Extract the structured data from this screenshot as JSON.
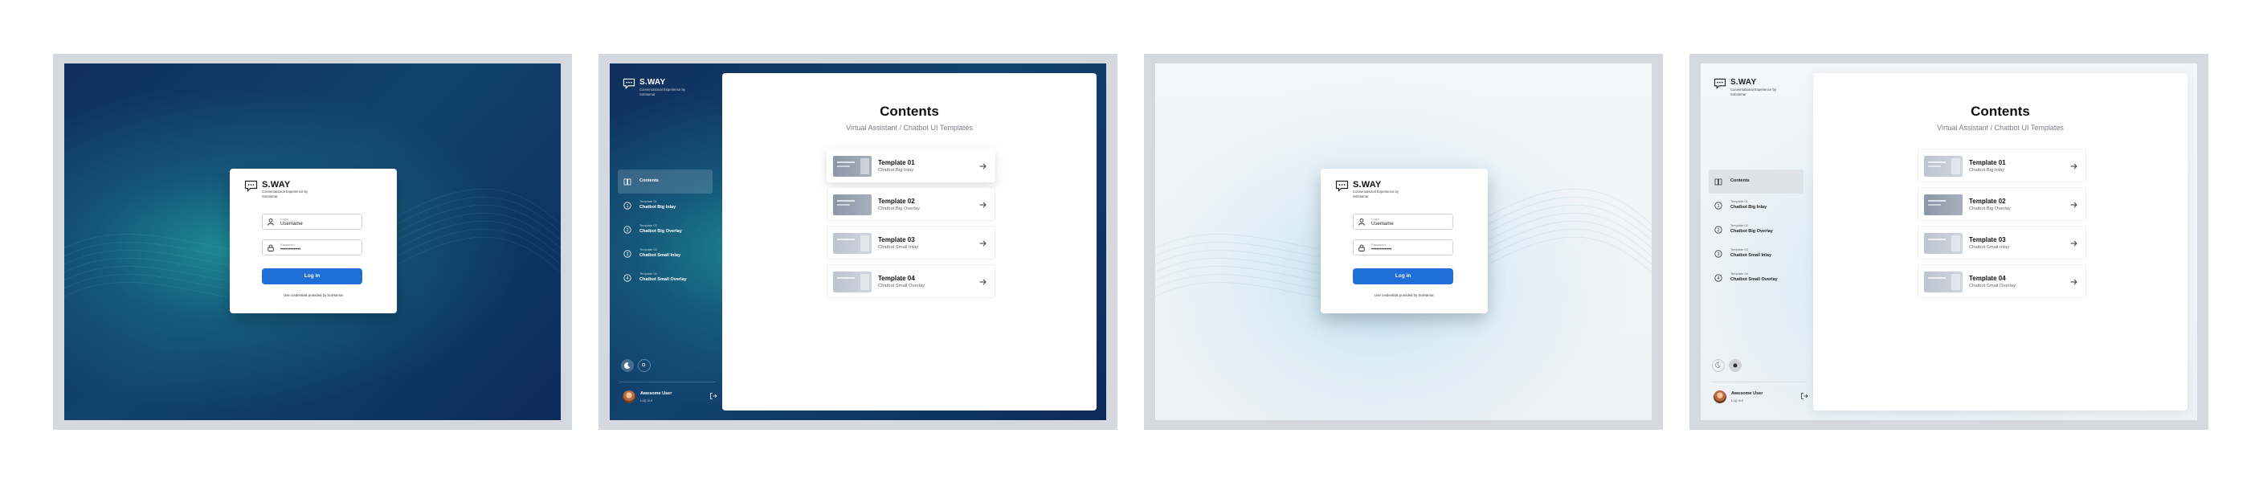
{
  "brand": {
    "name": "S.WAY",
    "tagline": "Conversational Experience by SotHarnar"
  },
  "login": {
    "id_label": "Login",
    "id_value": "Username",
    "pw_label": "Password",
    "pw_value": "••••••••••••",
    "button": "Log in",
    "note": "Use credentials provided by SotHarnar"
  },
  "content": {
    "title": "Contents",
    "subtitle": "Virtual Assistant / Chatbot UI Templates",
    "templates": [
      {
        "name": "Template 01",
        "desc": "Chatbot Big Inlay"
      },
      {
        "name": "Template 02",
        "desc": "Chatbot Big Overlay"
      },
      {
        "name": "Template 03",
        "desc": "Chatbot Small Inlay"
      },
      {
        "name": "Template 04",
        "desc": "Chatbot Small Overlay"
      }
    ]
  },
  "nav": {
    "contents": "Contents",
    "items": [
      {
        "sub": "Template 01",
        "title": "Chatbot Big Inlay"
      },
      {
        "sub": "Template 02",
        "title": "Chatbot Big Overlay"
      },
      {
        "sub": "Template 03",
        "title": "Chatbot Small Inlay"
      },
      {
        "sub": "Template 04",
        "title": "Chatbot Small Overlay"
      }
    ]
  },
  "user": {
    "name": "Awesome User",
    "logout": "Log out"
  },
  "icons": [
    "chat-bubble-logo-icon",
    "user-icon",
    "lock-icon",
    "book-icon",
    "number-1-icon",
    "number-2-icon",
    "number-3-icon",
    "number-4-icon",
    "moon-icon",
    "sun-icon",
    "logout-icon",
    "arrow-right-icon"
  ],
  "colors": {
    "accent": "#1f6fd6",
    "dark_bg": "#0f2f5c",
    "teal_glow": "#2096a0",
    "light_bg": "#f4f6f9"
  }
}
